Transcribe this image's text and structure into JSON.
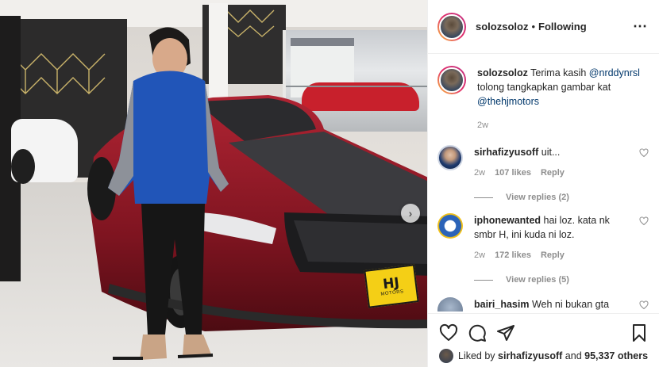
{
  "post": {
    "author": "solozsoloz",
    "separator": "•",
    "follow_status": "Following",
    "more_icon": "more-options-icon",
    "plate_logo": "HJ",
    "plate_text": "MOTORS"
  },
  "caption": {
    "user": "solozsoloz",
    "text_1": "Terima kasih ",
    "mention_1": "@nrddynrsl",
    "text_2": " tolong tangkapkan gambar kat ",
    "mention_2": "@thehjmotors",
    "time": "2w"
  },
  "comments": [
    {
      "user": "sirhafizyusoff",
      "text": "uit...",
      "time": "2w",
      "likes": "107 likes",
      "reply": "Reply",
      "replies": "View replies (2)"
    },
    {
      "user": "iphonewanted",
      "text": "hai loz. kata nk smbr H, ini kuda ni loz.",
      "time": "2w",
      "likes": "172 likes",
      "reply": "Reply",
      "replies": "View replies (5)"
    },
    {
      "user": "bairi_hasim",
      "text": "Weh ni bukan gta"
    }
  ],
  "footer": {
    "liked_prefix": "Liked by ",
    "liked_user": "sirhafizyusoff",
    "liked_and": " and ",
    "liked_count": "95,337 others"
  },
  "colors": {
    "mention": "#00376b",
    "muted": "#8e8e8e",
    "text": "#262626",
    "car_red": "#8e1a26",
    "plate_yellow": "#f4cf16"
  }
}
